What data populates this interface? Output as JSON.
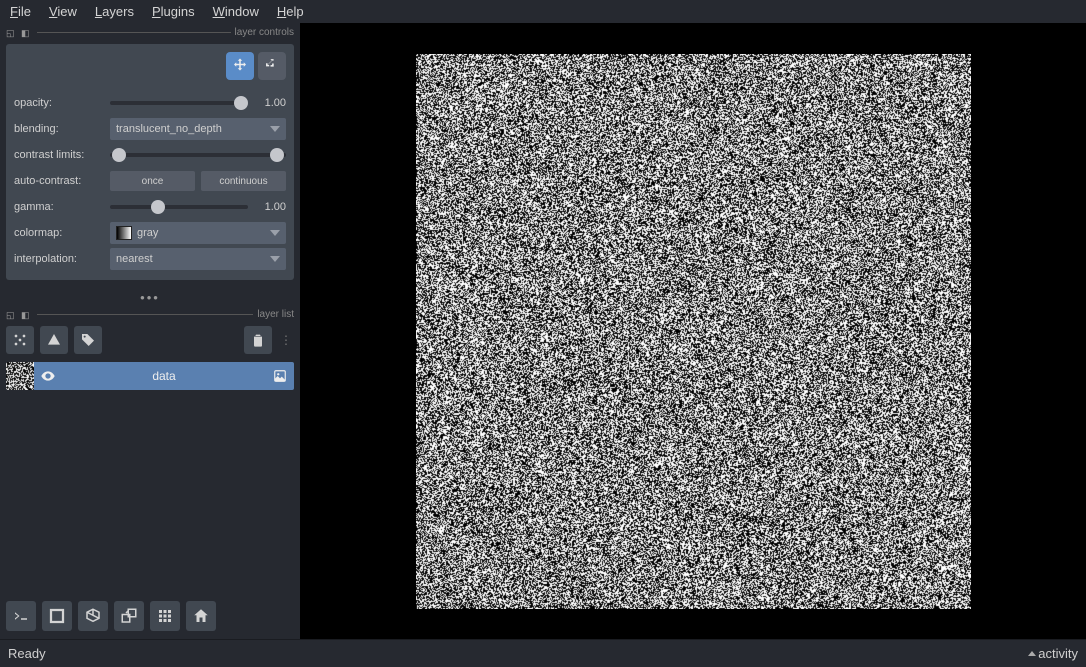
{
  "menu": {
    "file": "File",
    "view": "View",
    "layers": "Layers",
    "plugins": "Plugins",
    "window": "Window",
    "help": "Help"
  },
  "sections": {
    "layer_controls": "layer controls",
    "layer_list": "layer list"
  },
  "controls": {
    "opacity": {
      "label": "opacity:",
      "value": "1.00",
      "pos": 100
    },
    "blending": {
      "label": "blending:",
      "value": "translucent_no_depth"
    },
    "contrast": {
      "label": "contrast limits:",
      "low": 0,
      "high": 100
    },
    "autocontrast": {
      "label": "auto-contrast:",
      "once": "once",
      "cont": "continuous"
    },
    "gamma": {
      "label": "gamma:",
      "value": "1.00",
      "pos": 35
    },
    "colormap": {
      "label": "colormap:",
      "value": "gray"
    },
    "interpolation": {
      "label": "interpolation:",
      "value": "nearest"
    }
  },
  "layer": {
    "name": "data"
  },
  "status": {
    "ready": "Ready",
    "activity": "activity"
  }
}
